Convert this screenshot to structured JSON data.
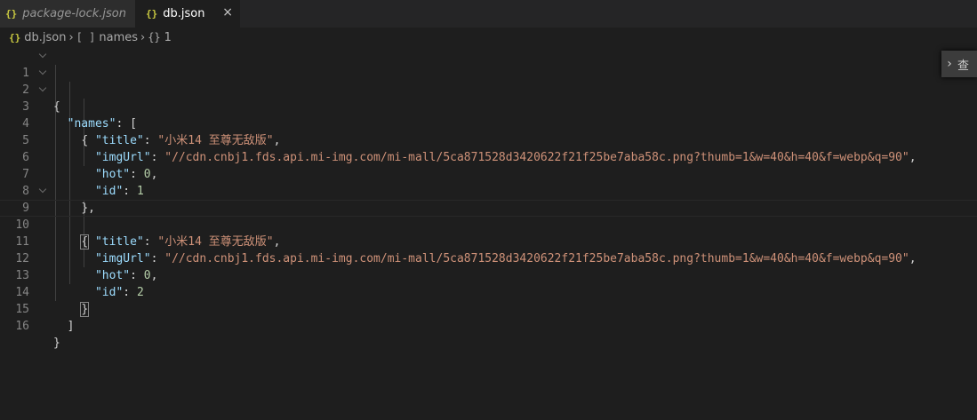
{
  "tabs": [
    {
      "icon": "{}",
      "label": "package-lock.json"
    },
    {
      "icon": "{}",
      "label": "db.json",
      "close": "×"
    }
  ],
  "breadcrumb": {
    "file_icon": "{}",
    "file": "db.json",
    "array_icon": "[ ]",
    "array": "names",
    "object_icon": "{}",
    "object": "1"
  },
  "find_widget": {
    "chevron": "›",
    "label": "查"
  },
  "lines": {
    "n1": "1",
    "n2": "2",
    "n3": "3",
    "n4": "4",
    "n5": "5",
    "n6": "6",
    "n7": "7",
    "n8": "8",
    "n9": "9",
    "n10": "10",
    "n11": "11",
    "n12": "12",
    "n13": "13",
    "n14": "14",
    "n15": "15",
    "n16": "16"
  },
  "code": {
    "l1": "{",
    "l2_key": "\"names\"",
    "l2_rest": ": [",
    "l3": "{",
    "l4_key": "\"title\"",
    "l4_val": "\"小米14 至尊无敌版\"",
    "l5_key": "\"imgUrl\"",
    "l5_val": "\"//cdn.cnbj1.fds.api.mi-img.com/mi-mall/5ca871528d3420622f21f25be7aba58c.png?thumb=1&w=40&h=40&f=webp&q=90\"",
    "l6_key": "\"hot\"",
    "l6_val": "0",
    "l7_key": "\"id\"",
    "l7_val": "1",
    "l8": "},",
    "l9": "{",
    "l10_key": "\"title\"",
    "l10_val": "\"小米14 至尊无敌版\"",
    "l11_key": "\"imgUrl\"",
    "l11_val": "\"//cdn.cnbj1.fds.api.mi-img.com/mi-mall/5ca871528d3420622f21f25be7aba58c.png?thumb=1&w=40&h=40&f=webp&q=90\"",
    "l12_key": "\"hot\"",
    "l12_val": "0",
    "l13_key": "\"id\"",
    "l13_val": "2",
    "l14": "}",
    "l15": "]",
    "l16": "}"
  },
  "colors": {
    "background": "#1e1e1e",
    "key": "#9cdcfe",
    "string": "#ce9178",
    "number": "#b5cea8",
    "json_icon": "#cbcb41"
  }
}
